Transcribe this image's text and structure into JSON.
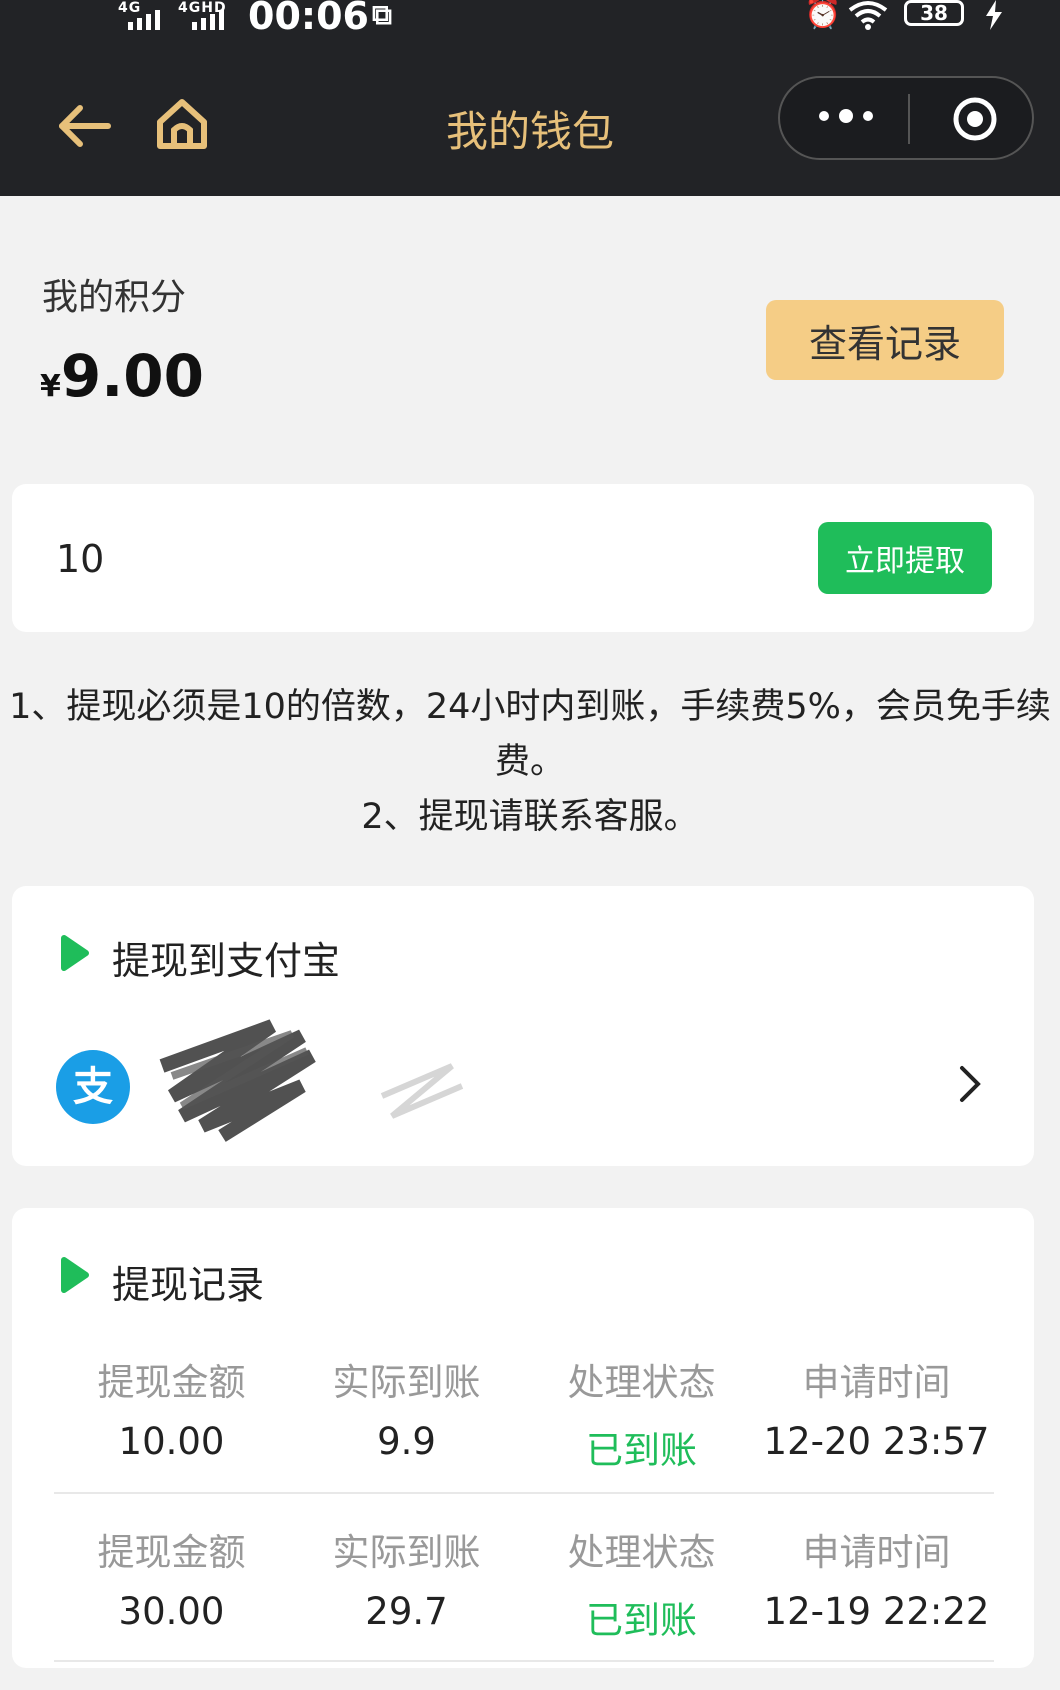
{
  "status_bar": {
    "signal1": "4G",
    "signal2": "4GHD",
    "time": "00:06",
    "battery": "38"
  },
  "nav": {
    "title": "我的钱包"
  },
  "points": {
    "label": "我的积分",
    "currency": "¥",
    "amount": "9.00",
    "record_button": "查看记录"
  },
  "withdraw": {
    "amount_value": "10",
    "button": "立即提取"
  },
  "notice": {
    "line1": "1、提现必须是10的倍数，24小时内到账，手续费5%，会员免手续费。",
    "line2": "2、提现请联系客服。"
  },
  "alipay": {
    "title": "提现到支付宝",
    "logo_char": "支"
  },
  "records": {
    "title": "提现记录",
    "headers": [
      "提现金额",
      "实际到账",
      "处理状态",
      "申请时间"
    ],
    "rows": [
      {
        "amount": "10.00",
        "actual": "9.9",
        "status": "已到账",
        "time": "12-20 23:57"
      },
      {
        "amount": "30.00",
        "actual": "29.7",
        "status": "已到账",
        "time": "12-19 22:22"
      }
    ]
  },
  "colors": {
    "accent_gold": "#e7c07a",
    "button_gold": "#f5cd86",
    "green": "#1fbd5a",
    "header_bg": "#222326"
  }
}
